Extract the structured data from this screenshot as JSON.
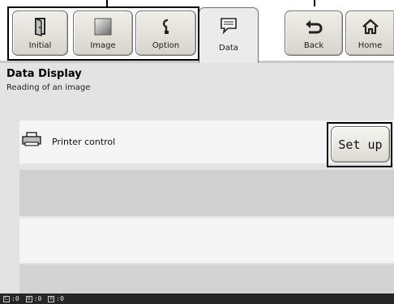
{
  "tabs": {
    "initial": {
      "label": "Initial",
      "icon": "door-icon"
    },
    "image": {
      "label": "Image",
      "icon": "image-icon"
    },
    "option": {
      "label": "Option",
      "icon": "option-icon"
    },
    "data": {
      "label": "Data",
      "icon": "speech-bubble-icon"
    },
    "back": {
      "label": "Back",
      "icon": "back-arrow-icon"
    },
    "home": {
      "label": "Home",
      "icon": "home-icon"
    }
  },
  "page": {
    "title": "Data Display",
    "subtitle": "Reading of an image"
  },
  "rows": [
    {
      "label": "Printer control",
      "icon": "printer-icon",
      "button_label": "Set up"
    }
  ],
  "status": [
    {
      "icon_letter": "C",
      "value": ":0"
    },
    {
      "icon_letter": "B",
      "value": ":0"
    },
    {
      "icon_letter": "R",
      "value": ":0"
    }
  ],
  "colors": {
    "panel_bg": "#e3e3e3",
    "status_bg": "#262626",
    "highlight_border": "#000000"
  }
}
